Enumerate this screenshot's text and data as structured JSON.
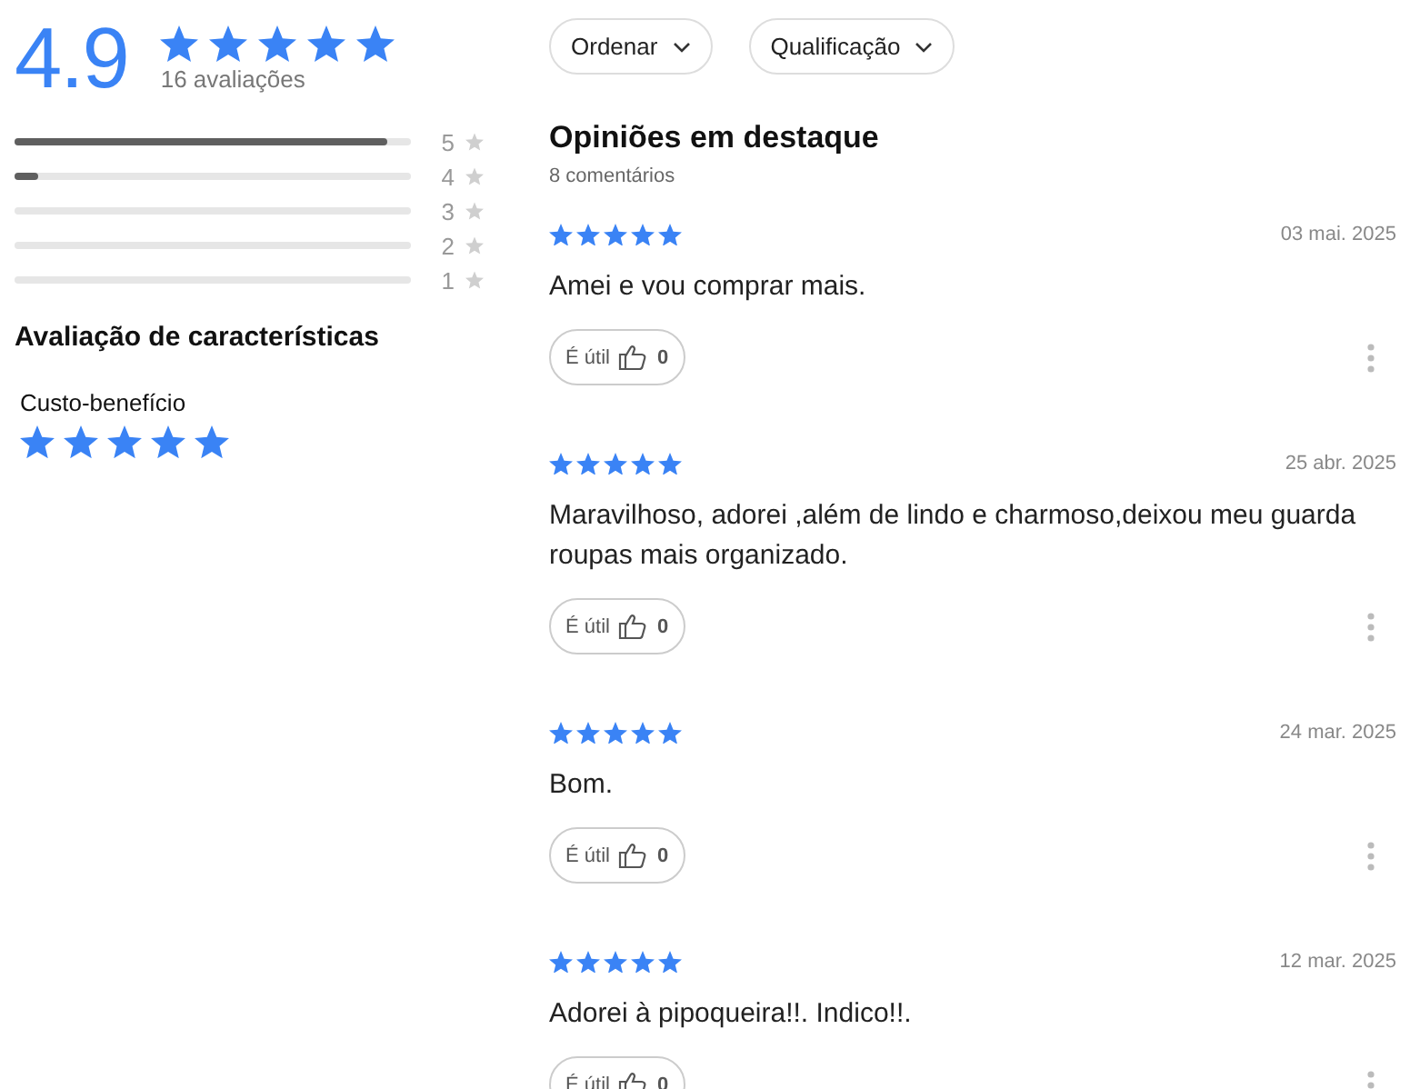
{
  "summary": {
    "average": "4.9",
    "stars": 5,
    "count": "16 avaliações"
  },
  "distribution": [
    {
      "label": "5",
      "level": 0.94
    },
    {
      "label": "4",
      "level": 0.06
    },
    {
      "label": "3"
    },
    {
      "label": "2"
    },
    {
      "label": "1"
    }
  ],
  "characteristics": {
    "title": "Avaliação de características",
    "items": [
      {
        "name": "Custo-benefício",
        "stars": 5
      }
    ]
  },
  "filters": [
    {
      "label": "Ordenar"
    },
    {
      "label": "Qualificação"
    }
  ],
  "reviews_header": {
    "title": "Opiniões em destaque",
    "count": "8 comentários"
  },
  "reviews": [
    {
      "stars": 5,
      "date": "03 mai. 2025",
      "text": "Amei e vou comprar mais.",
      "useful_label": "É útil",
      "useful_count": "0"
    },
    {
      "stars": 5,
      "date": "25 abr. 2025",
      "text": "Maravilhoso, adorei ,além de lindo e charmoso,deixou meu guarda roupas mais organizado.",
      "useful_label": "É útil",
      "useful_count": "0"
    },
    {
      "stars": 5,
      "date": "24 mar. 2025",
      "text": "Bom.",
      "useful_label": "É útil",
      "useful_count": "0"
    },
    {
      "stars": 5,
      "date": "12 mar. 2025",
      "text": "Adorei à pipoqueira!!. Indico!!.",
      "useful_label": "É útil",
      "useful_count": "0"
    }
  ]
}
